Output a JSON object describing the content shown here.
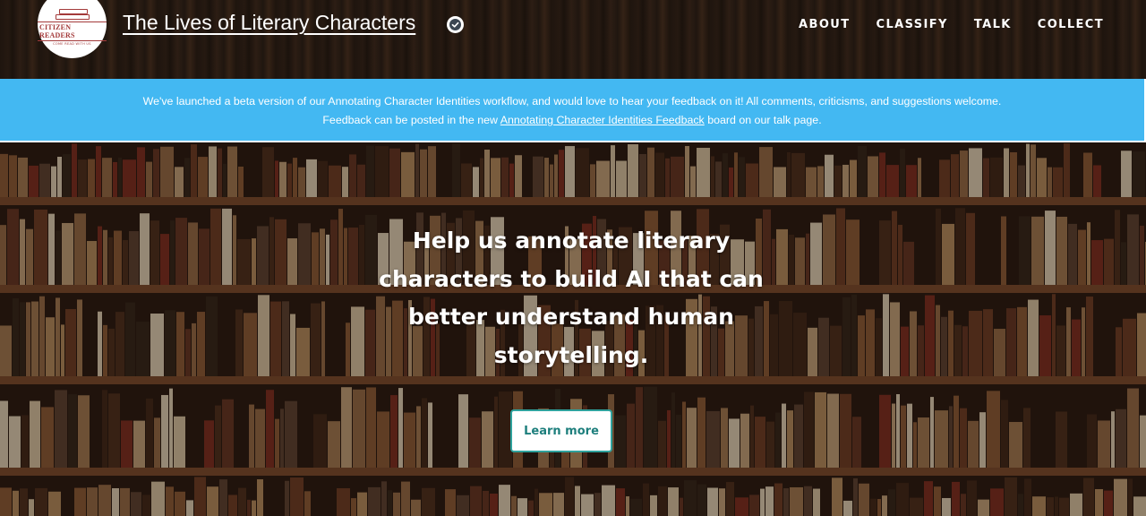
{
  "header": {
    "logo_text": "CITIZEN READERS",
    "logo_subtext": "COME READ WITH US",
    "title": "The Lives of Literary Characters",
    "nav": [
      {
        "label": "ABOUT"
      },
      {
        "label": "CLASSIFY"
      },
      {
        "label": "TALK"
      },
      {
        "label": "COLLECT"
      }
    ]
  },
  "announcement": {
    "line1": "We've launched a beta version of our Annotating Character Identities workflow, and would love to hear your feedback on it! All comments, criticisms, and suggestions welcome.",
    "line2_before": "Feedback can be posted in the new ",
    "link_text": "Annotating Character Identities Feedback",
    "line2_after": " board on our talk page."
  },
  "hero": {
    "heading": "Help us annotate literary characters to build AI that can better understand human storytelling.",
    "button_label": "Learn more"
  },
  "colors": {
    "announcement_bg": "#43b8f2",
    "button_border": "#2fa29d",
    "logo_red": "#a33a3a"
  },
  "icons": {
    "verified": "check-badge-icon",
    "logo": "book-stack-logo"
  }
}
